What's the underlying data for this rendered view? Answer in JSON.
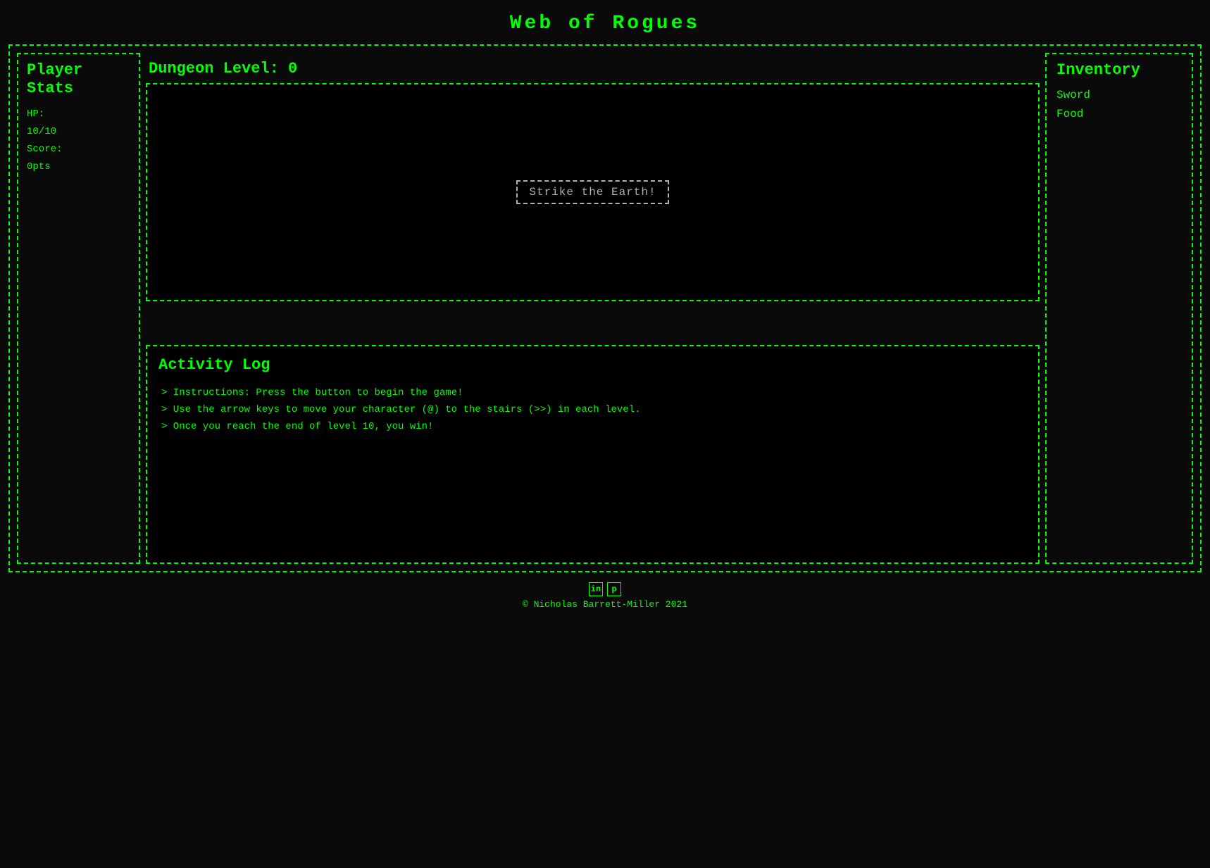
{
  "page": {
    "title": "Web   of   Rogues"
  },
  "header": {
    "dungeon_level_label": "Dungeon Level: 0"
  },
  "left_panel": {
    "title_line1": "Player",
    "title_line2": "Stats",
    "stats": [
      {
        "label": "HP:",
        "value": "10/10"
      },
      {
        "label": "Score:",
        "value": "0pts"
      }
    ]
  },
  "game_viewport": {
    "button_label": "Strike the Earth!"
  },
  "activity_log": {
    "title": "Activity Log",
    "lines": [
      "> Instructions: Press the button to begin the game!",
      "> Use the arrow keys to move your character (@) to the stairs (>>) in each level.",
      "> Once you reach the end of level 10, you win!"
    ]
  },
  "inventory": {
    "title": "Inventory",
    "items": [
      "Sword",
      "Food"
    ]
  },
  "footer": {
    "copyright": "© Nicholas Barrett-Miller 2021",
    "icons": [
      "in",
      "p"
    ]
  }
}
